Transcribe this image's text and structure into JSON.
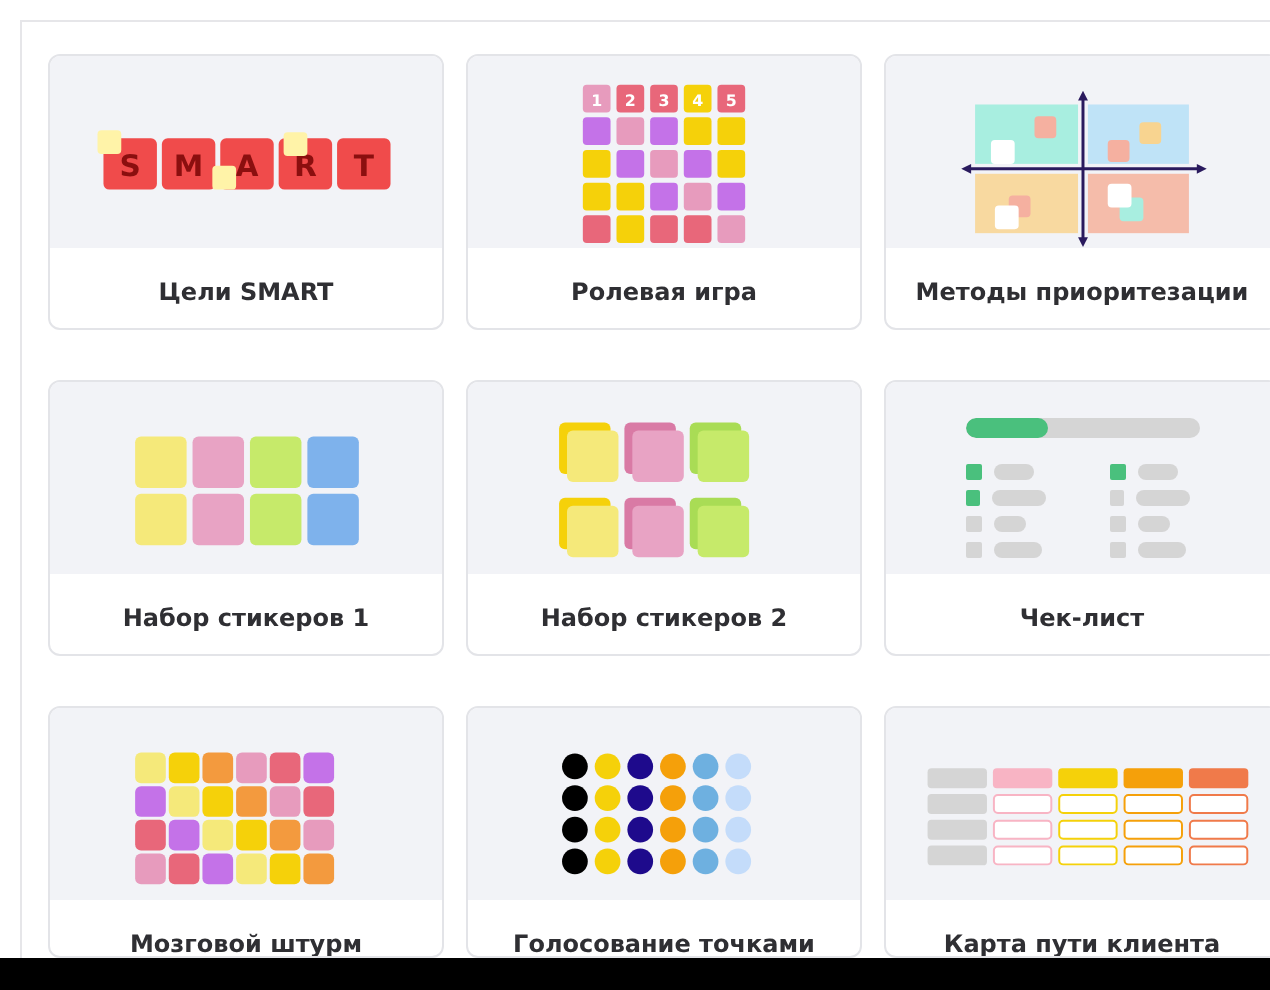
{
  "templates": [
    {
      "title": "Цели SMART",
      "kind": "smart",
      "letters": [
        "S",
        "M",
        "A",
        "R",
        "T"
      ]
    },
    {
      "title": "Ролевая игра",
      "kind": "roleplay",
      "numbers": [
        "1",
        "2",
        "3",
        "4",
        "5"
      ]
    },
    {
      "title": "Методы приоритезации",
      "kind": "quadrants"
    },
    {
      "title": "Набор стикеров 1",
      "kind": "stickers"
    },
    {
      "title": "Набор стикеров 2",
      "kind": "stacked-stickers"
    },
    {
      "title": "Чек-лист",
      "kind": "checklist",
      "level": 0.35,
      "columns": [
        {
          "items": [
            {
              "checked": true
            },
            {
              "checked": true
            },
            {
              "checked": false
            },
            {
              "checked": false
            }
          ]
        },
        {
          "items": [
            {
              "checked": true
            },
            {
              "checked": false
            },
            {
              "checked": false
            },
            {
              "checked": false
            }
          ]
        }
      ]
    },
    {
      "title": "Мозговой штурм",
      "kind": "brainstorm"
    },
    {
      "title": "Голосование точками",
      "kind": "dots"
    },
    {
      "title": "Карта пути клиента",
      "kind": "journey"
    }
  ]
}
